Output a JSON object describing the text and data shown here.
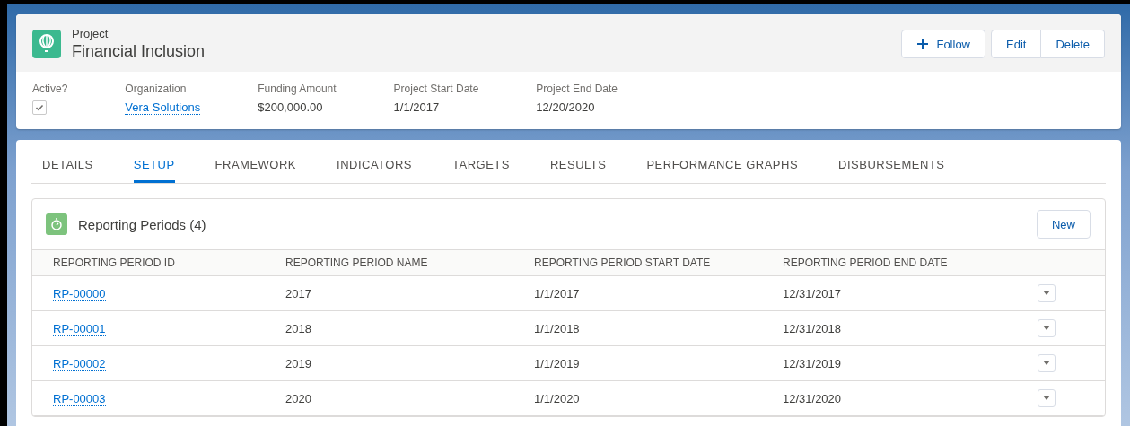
{
  "header": {
    "object_type": "Project",
    "title": "Financial Inclusion",
    "buttons": [
      {
        "kind": "follow",
        "label": "Follow"
      },
      {
        "kind": "group",
        "label": "Edit"
      },
      {
        "kind": "group",
        "label": "Delete"
      }
    ]
  },
  "fields": [
    {
      "kind": "checkbox",
      "label": "Active?",
      "checked": true
    },
    {
      "kind": "link",
      "label": "Organization",
      "value": "Vera Solutions"
    },
    {
      "kind": "text",
      "label": "Funding Amount",
      "value": "$200,000.00"
    },
    {
      "kind": "text",
      "label": "Project Start Date",
      "value": "1/1/2017"
    },
    {
      "kind": "text",
      "label": "Project End Date",
      "value": "12/20/2020"
    }
  ],
  "tabs": [
    {
      "label": "DETAILS",
      "selected": false
    },
    {
      "label": "SETUP",
      "selected": true
    },
    {
      "label": "FRAMEWORK",
      "selected": false
    },
    {
      "label": "INDICATORS",
      "selected": false
    },
    {
      "label": "TARGETS",
      "selected": false
    },
    {
      "label": "RESULTS",
      "selected": false
    },
    {
      "label": "PERFORMANCE GRAPHS",
      "selected": false
    },
    {
      "label": "DISBURSEMENTS",
      "selected": false
    }
  ],
  "related_list": {
    "title": "Reporting Periods (4)",
    "new_button": "New",
    "columns": [
      "REPORTING PERIOD ID",
      "REPORTING PERIOD NAME",
      "REPORTING PERIOD START DATE",
      "REPORTING PERIOD END DATE"
    ],
    "rows": [
      [
        "RP-00000",
        "2017",
        "1/1/2017",
        "12/31/2017"
      ],
      [
        "RP-00001",
        "2018",
        "1/1/2018",
        "12/31/2018"
      ],
      [
        "RP-00002",
        "2019",
        "1/1/2019",
        "12/31/2019"
      ],
      [
        "RP-00003",
        "2020",
        "1/1/2020",
        "12/31/2020"
      ]
    ]
  }
}
